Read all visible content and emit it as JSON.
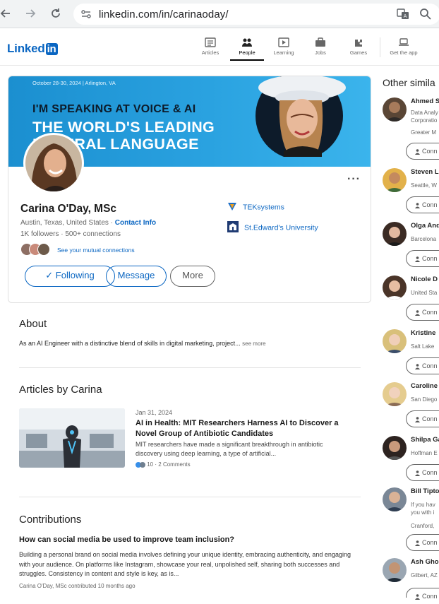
{
  "browser": {
    "url": "linkedin.com/in/carinaoday/",
    "back_icon": "arrow-left-icon",
    "forward_icon": "arrow-right-icon",
    "reload_icon": "reload-icon"
  },
  "header": {
    "logo_text": "Linked",
    "logo_box": "in",
    "nav": [
      {
        "label": "Articles",
        "icon": "articles-icon"
      },
      {
        "label": "People",
        "icon": "people-icon",
        "active": true
      },
      {
        "label": "Learning",
        "icon": "learning-icon"
      },
      {
        "label": "Jobs",
        "icon": "jobs-icon"
      },
      {
        "label": "Games",
        "icon": "games-icon"
      },
      {
        "label": "Get the app",
        "icon": "laptop-icon"
      }
    ]
  },
  "profile": {
    "banner": {
      "date": "October 28-30, 2024 | Arlington, VA",
      "line1": "I'M SPEAKING AT VOICE & AI",
      "line2": "THE WORLD'S LEADING",
      "line3": "NATURAL LANGUAGE"
    },
    "name": "Carina O'Day, MSc",
    "location": "Austin, Texas, United States",
    "contact_link": "Contact Info",
    "followers": "1K followers",
    "connections": "500+ connections",
    "mutual": "See your mutual connections",
    "companies": [
      {
        "name": "TEKsystems"
      },
      {
        "name": "St.Edward's University"
      }
    ],
    "buttons": {
      "following": "Following",
      "message": "Message",
      "more": "More"
    },
    "more_dots": "···"
  },
  "about": {
    "title": "About",
    "text": "As an AI Engineer with a distinctive blend of skills in digital marketing, project...",
    "see_more": "see more"
  },
  "articles": {
    "title": "Articles by Carina",
    "items": [
      {
        "date": "Jan 31, 2024",
        "title": "AI in Health: MIT Researchers Harness AI to Discover a Novel Group of Antibiotic Candidates",
        "excerpt": "MIT researchers have made a significant breakthrough in antibiotic discovery using deep learning, a type of artificial...",
        "reactions": "10",
        "comments": "2 Comments"
      }
    ]
  },
  "contributions": {
    "title": "Contributions",
    "question": "How can social media be used to improve team inclusion?",
    "body": "Building a personal brand on social media involves defining your unique identity, embracing authenticity, and engaging with your audience. On platforms like Instagram, showcase your real, unpolished self, sharing both successes and struggles. Consistency in content and style is key, as is...",
    "meta": "Carina O'Day, MSc contributed 10 months ago"
  },
  "rail": {
    "title": "Other simila",
    "connect_label": "Conn",
    "people": [
      {
        "name": "Ahmed S",
        "sub": [
          "Data Analy",
          "Corporatio",
          "Greater M"
        ]
      },
      {
        "name": "Steven L",
        "sub": [
          "Seattle, W"
        ]
      },
      {
        "name": "Olga And",
        "sub": [
          "Barcelona"
        ]
      },
      {
        "name": "Nicole D",
        "sub": [
          "United Sta"
        ]
      },
      {
        "name": "Kristine",
        "sub": [
          "Salt Lake"
        ]
      },
      {
        "name": "Caroline",
        "sub": [
          "San Diego"
        ]
      },
      {
        "name": "Shilpa Ga",
        "sub": [
          "Hoffman E"
        ]
      },
      {
        "name": "Bill Tipto",
        "sub": [
          "If you hav",
          "you with i",
          "Cranford,"
        ]
      },
      {
        "name": "Ash Gho",
        "sub": [
          "Gilbert, AZ"
        ]
      }
    ]
  }
}
